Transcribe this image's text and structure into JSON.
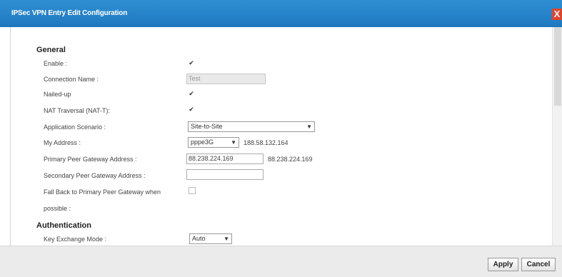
{
  "dialog": {
    "title": "IPSec VPN Entry Edit Configuration",
    "close_glyph": "X"
  },
  "general": {
    "heading": "General",
    "enable": {
      "label": "Enable :",
      "checked": true
    },
    "connection_name": {
      "label": "Connection Name :",
      "value": "Test"
    },
    "nailed_up": {
      "label": "Nailed-up",
      "checked": true
    },
    "nat_traversal": {
      "label": "NAT Traversal (NAT-T):",
      "checked": true
    },
    "application_scenario": {
      "label": "Application Scenario :",
      "value": "Site-to-Site"
    },
    "my_address": {
      "label": "My Address :",
      "value": "pppe3G",
      "ip": "188.58.132.164"
    },
    "primary_peer": {
      "label": "Primary Peer Gateway Address :",
      "value": "88.238.224.169",
      "display": "88.238.224.169"
    },
    "secondary_peer": {
      "label": "Secondary Peer Gateway Address :",
      "value": ""
    },
    "fallback": {
      "label_line1": "Fall Back to Primary Peer Gateway when",
      "label_line2": "possible :",
      "checked": false
    }
  },
  "authentication": {
    "heading": "Authentication",
    "key_exchange_mode": {
      "label": "Key Exchange Mode :",
      "value": "Auto"
    }
  },
  "footer": {
    "apply_label": "Apply",
    "cancel_label": "Cancel"
  },
  "glyphs": {
    "check": "✔",
    "dropdown": "▼"
  }
}
